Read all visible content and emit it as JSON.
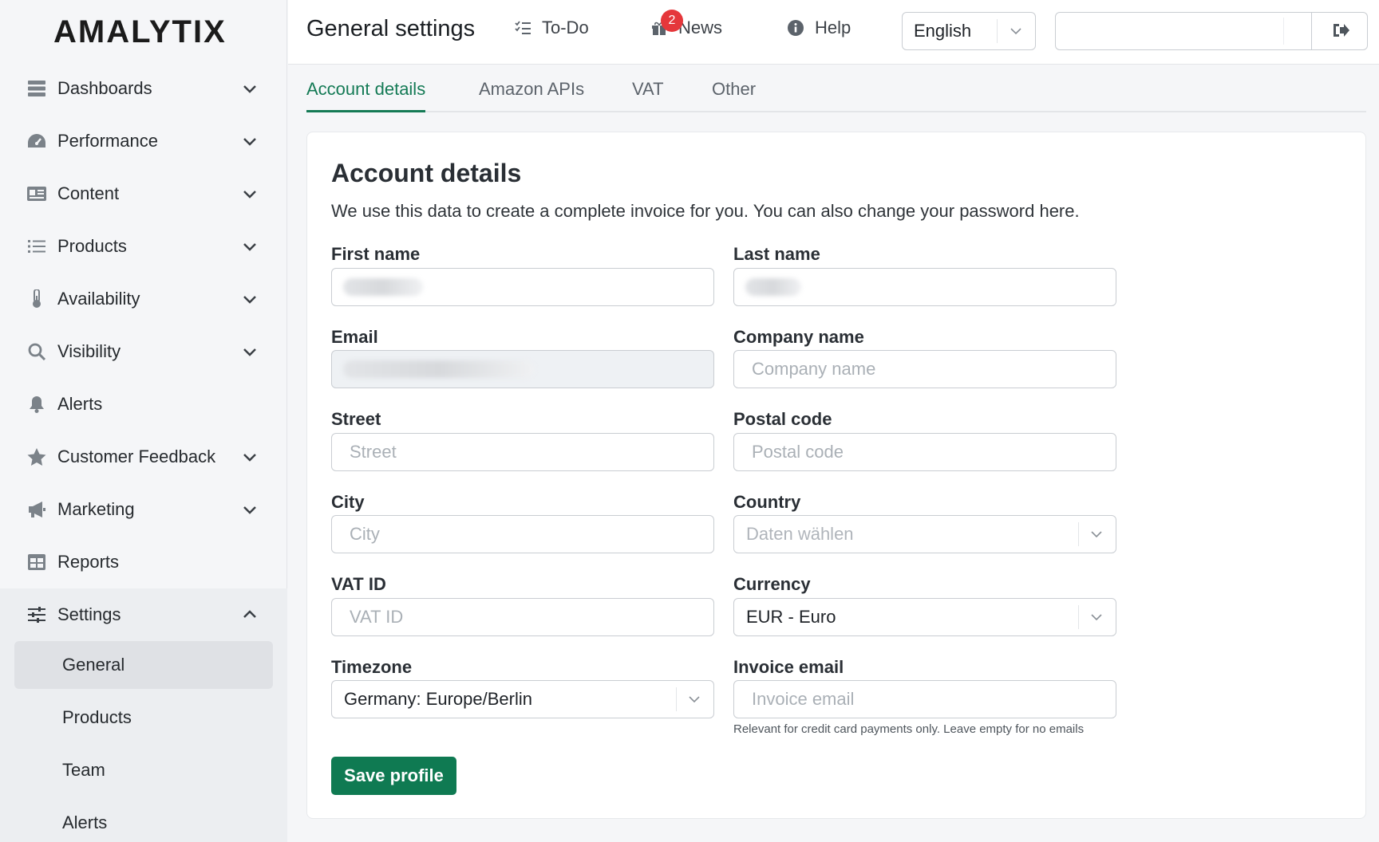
{
  "brand": {
    "logo": "AMALYTIX"
  },
  "sidebar": {
    "items": [
      {
        "label": "Dashboards",
        "icon": "dashboard-icon"
      },
      {
        "label": "Performance",
        "icon": "speedometer-icon"
      },
      {
        "label": "Content",
        "icon": "id-card-icon"
      },
      {
        "label": "Products",
        "icon": "list-icon"
      },
      {
        "label": "Availability",
        "icon": "thermometer-icon"
      },
      {
        "label": "Visibility",
        "icon": "search-icon"
      },
      {
        "label": "Alerts",
        "icon": "bell-icon"
      },
      {
        "label": "Customer Feedback",
        "icon": "star-icon"
      },
      {
        "label": "Marketing",
        "icon": "megaphone-icon"
      },
      {
        "label": "Reports",
        "icon": "table-icon"
      },
      {
        "label": "Settings",
        "icon": "sliders-icon"
      }
    ],
    "settings_sub": [
      "General",
      "Products",
      "Team",
      "Alerts"
    ],
    "active_sub": "General"
  },
  "header": {
    "title": "General settings",
    "todo_label": "To-Do",
    "news_label": "News",
    "news_badge": "2",
    "help_label": "Help",
    "language": "English"
  },
  "tabs": [
    "Account details",
    "Amazon APIs",
    "VAT",
    "Other"
  ],
  "form": {
    "title": "Account details",
    "description": "We use this data to create a complete invoice for you. You can also change your password here.",
    "first_name_label": "First name",
    "last_name_label": "Last name",
    "email_label": "Email",
    "company_label": "Company name",
    "company_placeholder": "Company name",
    "street_label": "Street",
    "street_placeholder": "Street",
    "postal_label": "Postal code",
    "postal_placeholder": "Postal code",
    "city_label": "City",
    "city_placeholder": "City",
    "country_label": "Country",
    "country_placeholder": "Daten wählen",
    "vat_label": "VAT ID",
    "vat_placeholder": "VAT ID",
    "currency_label": "Currency",
    "currency_value": "EUR - Euro",
    "timezone_label": "Timezone",
    "timezone_value": "Germany: Europe/Berlin",
    "invoice_email_label": "Invoice email",
    "invoice_email_placeholder": "Invoice email",
    "invoice_email_hint": "Relevant for credit card payments only. Leave empty for no emails",
    "save_label": "Save profile"
  },
  "colors": {
    "accent": "#147a55",
    "button": "#0f7a52",
    "badge": "#e5373b"
  }
}
